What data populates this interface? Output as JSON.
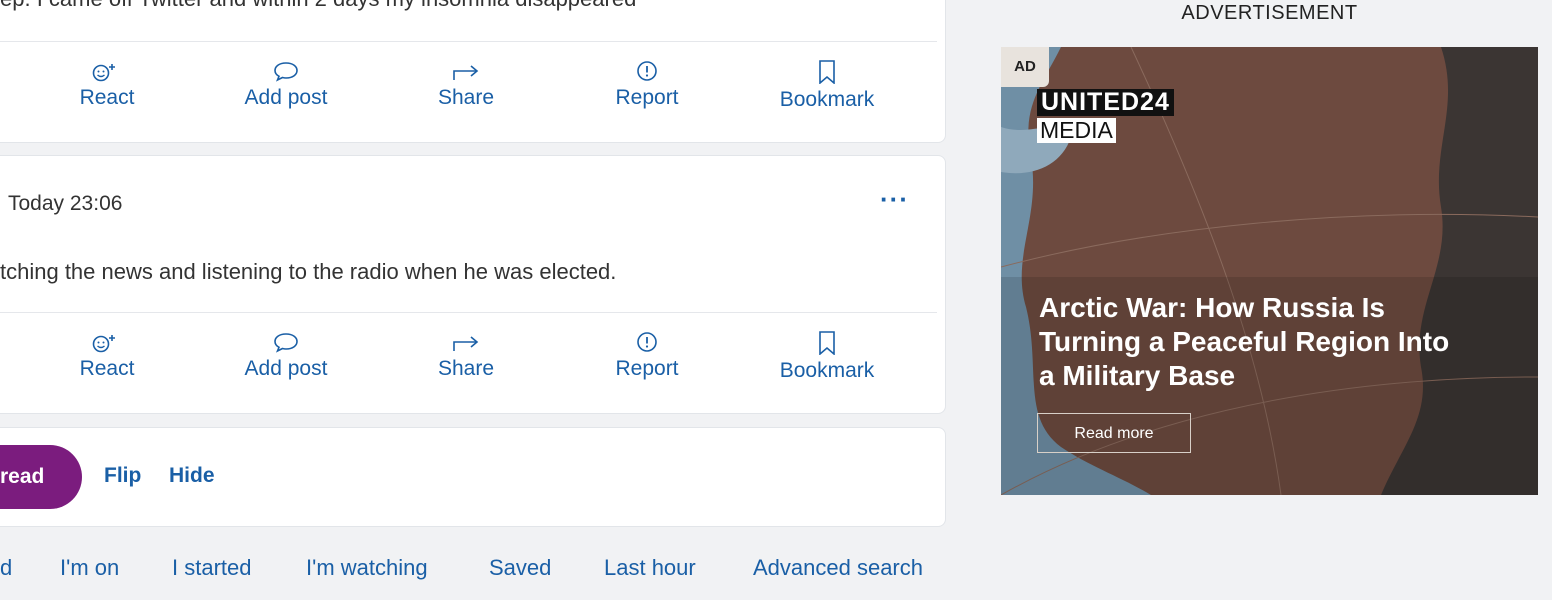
{
  "posts": [
    {
      "text": "ep. I came off Twitter and within 2 days my insomnia disappeared",
      "actions": [
        "React",
        "Add post",
        "Share",
        "Report",
        "Bookmark"
      ]
    },
    {
      "timestamp": "Today 23:06",
      "more": "···",
      "text": "tching the news and listening to the radio when he was elected.",
      "actions": [
        "React",
        "Add post",
        "Share",
        "Report",
        "Bookmark"
      ]
    }
  ],
  "thread_actions": {
    "primary": "read",
    "flip": "Flip",
    "hide": "Hide"
  },
  "footer_links": [
    "d",
    "I'm on",
    "I started",
    "I'm watching",
    "Saved",
    "Last hour",
    "Advanced search"
  ],
  "ad": {
    "label": "ADVERTISEMENT",
    "tag": "AD",
    "brand_line1": "UNITED24",
    "brand_line2": "MEDIA",
    "headline": "Arctic War: How Russia Is Turning a Peaceful Region Into a Military Base",
    "cta": "Read more"
  },
  "colors": {
    "link": "#1a5fa6",
    "primary_button": "#7b1c7e",
    "background": "#f1f2f4"
  },
  "icons": [
    "react-icon",
    "add-post-icon",
    "share-icon",
    "report-icon",
    "bookmark-icon"
  ]
}
